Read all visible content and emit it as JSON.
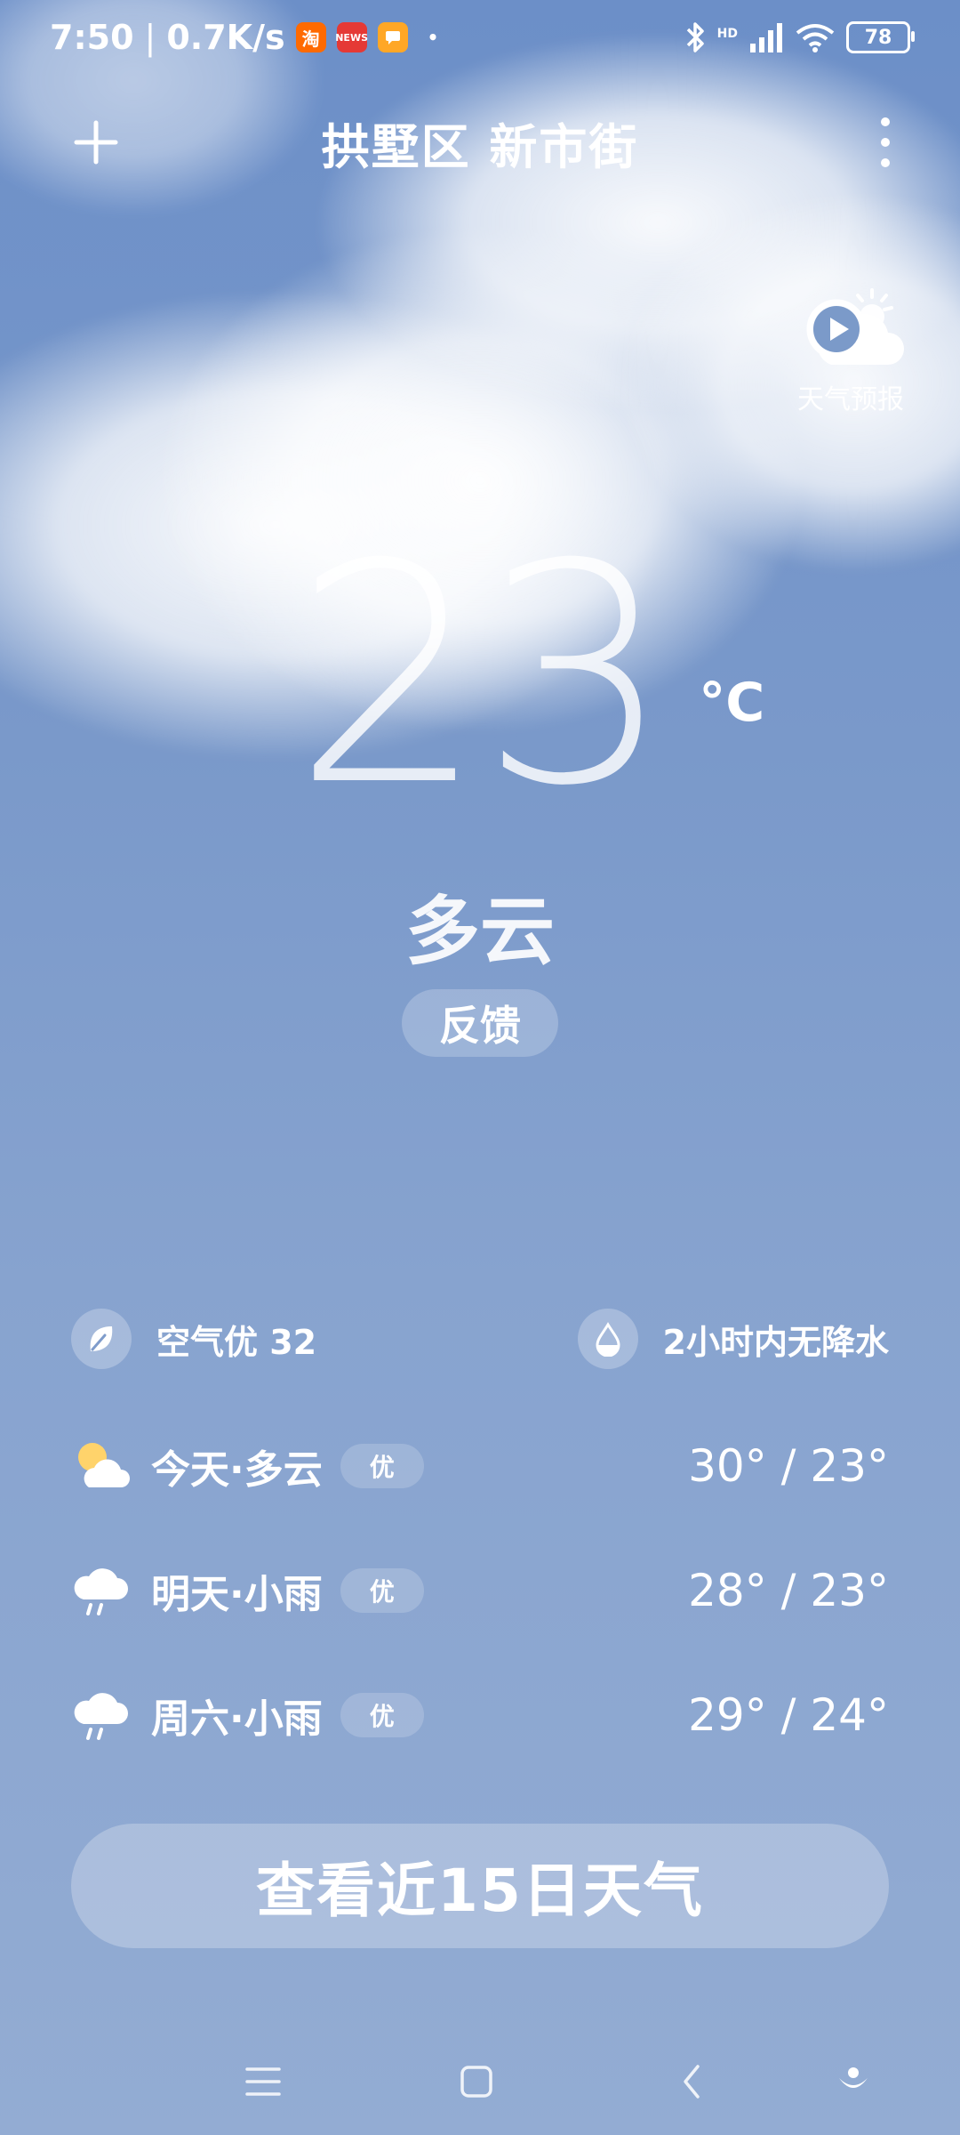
{
  "status_bar": {
    "time": "7:50",
    "speed": "0.7K/s",
    "apps": [
      {
        "icon": "taobao-icon",
        "text": "淘",
        "color": "#ff6a00"
      },
      {
        "icon": "news-app-icon",
        "text": "NEWS",
        "color": "#e53935"
      },
      {
        "icon": "message-app-icon",
        "text": "",
        "color": "#ffa726"
      }
    ],
    "network": "HD",
    "battery": "78"
  },
  "header": {
    "location": "拱墅区 新市街"
  },
  "forecast_video": {
    "label": "天气预报"
  },
  "current": {
    "temperature": "23",
    "unit": "°C",
    "condition": "多云",
    "feedback_label": "反馈"
  },
  "info": {
    "air": "空气优 32",
    "rain": "2小时内无降水"
  },
  "daily": [
    {
      "label": "今天·多云",
      "aqi": "优",
      "temp": "30° / 23°",
      "icon": "partly-cloudy-icon"
    },
    {
      "label": "明天·小雨",
      "aqi": "优",
      "temp": "28° / 23°",
      "icon": "light-rain-icon"
    },
    {
      "label": "周六·小雨",
      "aqi": "优",
      "temp": "29° / 24°",
      "icon": "light-rain-icon"
    }
  ],
  "cta": {
    "label": "查看近15日天气"
  },
  "nav": [
    "menu-icon",
    "home-icon",
    "back-icon",
    "assistant-icon"
  ]
}
